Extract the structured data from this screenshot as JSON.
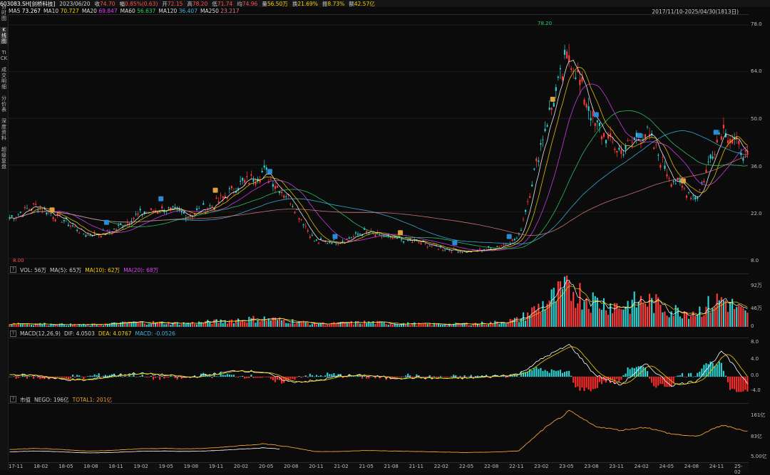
{
  "topbar": {
    "symbol": "603083.SH[剑桥科技]",
    "date": "2023/06/20",
    "close_label": "收",
    "close": "74.70",
    "change_label": "幅",
    "change": "0.85%(0.63)",
    "open_label": "开",
    "open": "72.15",
    "high_label": "高",
    "high": "78.20",
    "low_label": "低",
    "low": "71.74",
    "avg_label": "均",
    "avg": "74.96",
    "vol_label": "量",
    "vol": "56.50万",
    "turnover_label": "换",
    "turnover": "21.69%",
    "amp_label": "振",
    "amp": "8.73%",
    "amount_label": "额",
    "amount": "42.57亿",
    "range": "2017/11/10-2025/04/30(1813日)"
  },
  "ma_legend": [
    {
      "label": "MA5",
      "value": "73.267",
      "color": "#ffffff"
    },
    {
      "label": "MA10",
      "value": "70.727",
      "color": "#f5d000"
    },
    {
      "label": "MA20",
      "value": "69.847",
      "color": "#e040fb"
    },
    {
      "label": "MA60",
      "value": "56.637",
      "color": "#29d36b"
    },
    {
      "label": "MA120",
      "value": "36.407",
      "color": "#3fb7e6"
    },
    {
      "label": "MA250",
      "value": "23.217",
      "color": "#e07a7a"
    }
  ],
  "sidebar": [
    {
      "label": "分时图",
      "active": false
    },
    {
      "label": "K线图",
      "active": true
    },
    {
      "label": "TICK",
      "active": false
    },
    {
      "label": "成交明细",
      "active": false
    },
    {
      "label": "分价表",
      "active": false
    },
    {
      "label": "深度资料",
      "active": false
    },
    {
      "label": "超级复盘",
      "active": false
    }
  ],
  "price_axis": [
    "78.0",
    "64.0",
    "50.0",
    "36.0",
    "22.0",
    "8.0"
  ],
  "price_labels": {
    "max": "78.20",
    "min": "8.00"
  },
  "vol_panel": {
    "title": "VOL: 56万",
    "ma5": "MA(5): 65万",
    "ma10": "MA(10): 62万",
    "ma20": "MA(20): 68万",
    "axis": [
      "92万",
      "46万",
      "0"
    ]
  },
  "macd_panel": {
    "title": "MACD(12,26,9)",
    "dif": "DIF: 4.0503",
    "dea": "DEA: 4.0767",
    "macd": "MACD: -0.0526",
    "axis": [
      "8.0",
      "4.0",
      "0.0",
      "-4.0"
    ]
  },
  "mv_panel": {
    "title": "市值",
    "nego": "NEGO: 196亿",
    "total": "TOTAL1: 201亿",
    "axis": [
      "161亿",
      "83亿",
      "5.00亿"
    ]
  },
  "x_axis": [
    "17-11",
    "18-02",
    "18-05",
    "18-08",
    "18-11",
    "19-02",
    "19-05",
    "19-08",
    "19-11",
    "20-02",
    "20-05",
    "20-08",
    "20-11",
    "21-02",
    "21-05",
    "21-08",
    "21-11",
    "22-02",
    "22-05",
    "22-08",
    "22-11",
    "23-02",
    "23-05",
    "23-08",
    "23-11",
    "24-02",
    "24-05",
    "24-08",
    "24-11",
    "25-02"
  ],
  "chart_data": {
    "type": "candlestick",
    "x": [
      "17-11",
      "18-02",
      "18-05",
      "18-08",
      "18-11",
      "19-02",
      "19-05",
      "19-08",
      "19-11",
      "20-02",
      "20-05",
      "20-08",
      "20-11",
      "21-02",
      "21-05",
      "21-08",
      "21-11",
      "22-02",
      "22-05",
      "22-08",
      "22-11",
      "23-02",
      "23-05",
      "23-08",
      "23-11",
      "24-02",
      "24-05",
      "24-08",
      "24-11",
      "25-02"
    ],
    "price": [
      20,
      24,
      20,
      15,
      16,
      21,
      23,
      21,
      24,
      30,
      34,
      26,
      13,
      13,
      16,
      14,
      13,
      11,
      10,
      11,
      14,
      46,
      70,
      48,
      40,
      46,
      32,
      26,
      48,
      38
    ],
    "volume": [
      8,
      6,
      5,
      4,
      6,
      9,
      8,
      7,
      10,
      14,
      16,
      12,
      6,
      7,
      9,
      7,
      6,
      5,
      6,
      8,
      14,
      45,
      75,
      50,
      40,
      52,
      32,
      30,
      55,
      22
    ],
    "macd_dif": [
      0.5,
      0.3,
      -0.6,
      -0.8,
      0.2,
      0.8,
      0.4,
      -0.2,
      0.6,
      1.5,
      1.0,
      -1.2,
      -1.0,
      0.2,
      0.3,
      -0.3,
      -0.2,
      -0.4,
      -0.3,
      0.1,
      0.6,
      4.5,
      7.5,
      0.5,
      -2,
      3,
      -2,
      -1,
      6,
      -1.5
    ],
    "market_value": [
      30,
      34,
      30,
      24,
      26,
      32,
      34,
      32,
      36,
      44,
      52,
      40,
      22,
      22,
      26,
      24,
      22,
      20,
      18,
      20,
      24,
      110,
      178,
      120,
      104,
      116,
      90,
      80,
      124,
      100
    ],
    "ylim": [
      8,
      78
    ],
    "max_label": "78.20",
    "min_label": "8.00"
  }
}
